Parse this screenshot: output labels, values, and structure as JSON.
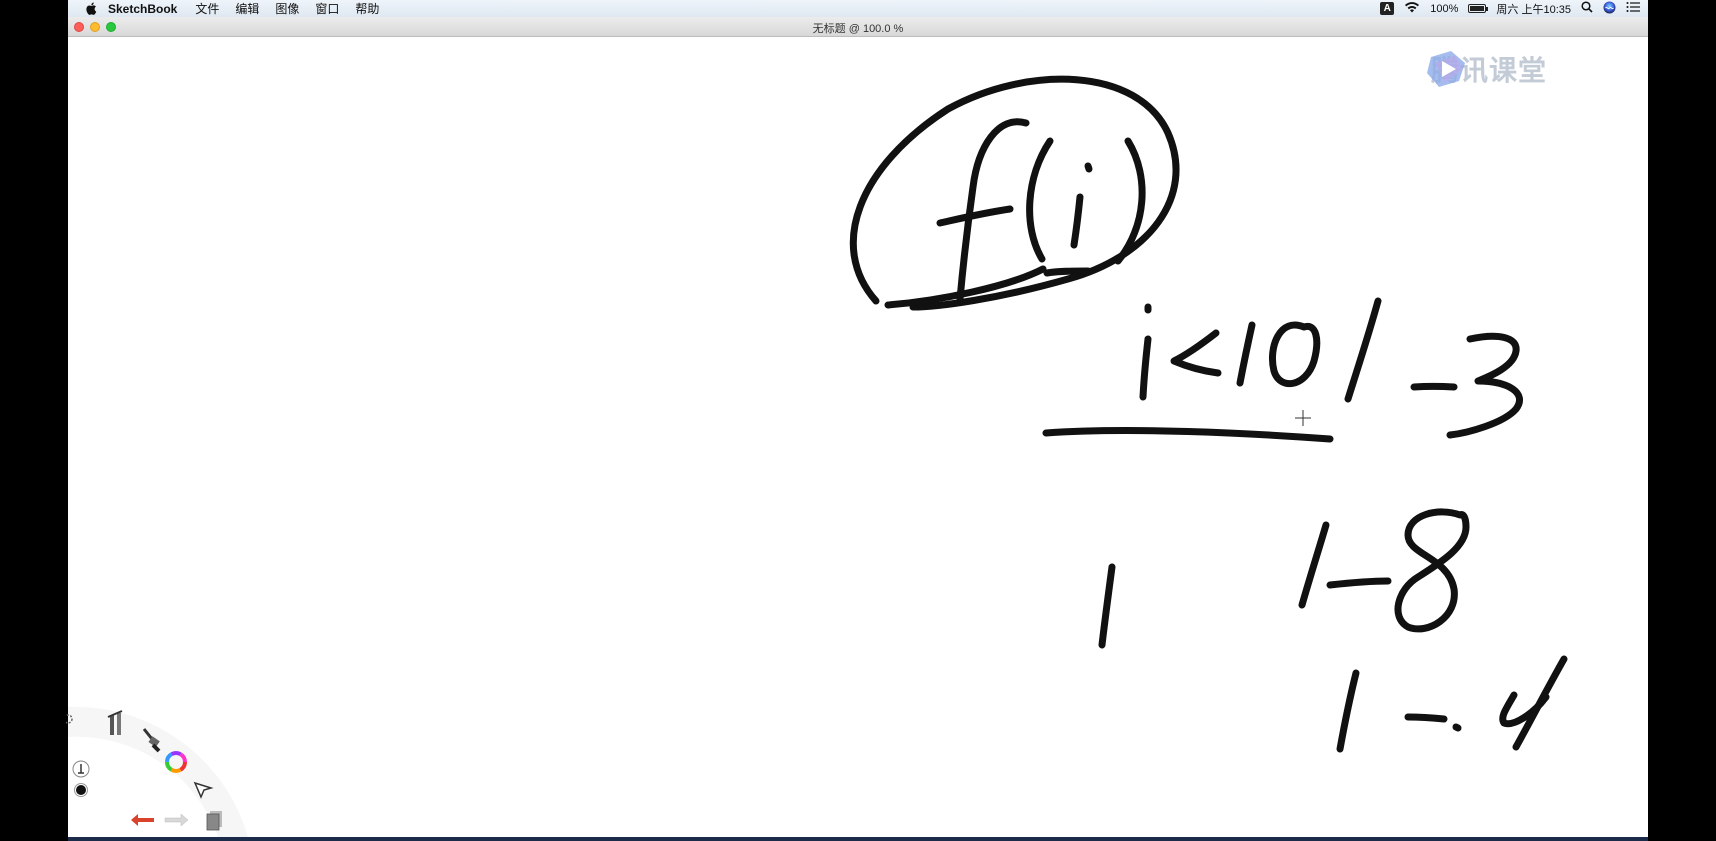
{
  "menubar": {
    "app_name": "SketchBook",
    "menus": [
      "文件",
      "编辑",
      "图像",
      "窗口",
      "帮助"
    ],
    "input_source": "A",
    "battery": "100%",
    "datetime": "周六 上午10:35"
  },
  "window": {
    "title": "无标题 @ 100.0 %"
  },
  "watermark": {
    "text": "腾讯课堂"
  },
  "colors": {
    "ink": "#111111",
    "canvas_bg": "#ffffff",
    "undo_arrow": "#d9432c"
  },
  "icons": {
    "apple": "apple-icon",
    "wifi": "wifi-icon",
    "battery": "battery-icon",
    "search": "search-icon",
    "siri": "siri-icon",
    "control_center": "control-center-icon",
    "watermark_logo": "play-logo-icon"
  },
  "lagoon_tools": [
    "settings",
    "ruler-tools",
    "brush",
    "color-wheel",
    "brush-puck",
    "color-puck",
    "selection",
    "undo",
    "redo",
    "layers"
  ]
}
